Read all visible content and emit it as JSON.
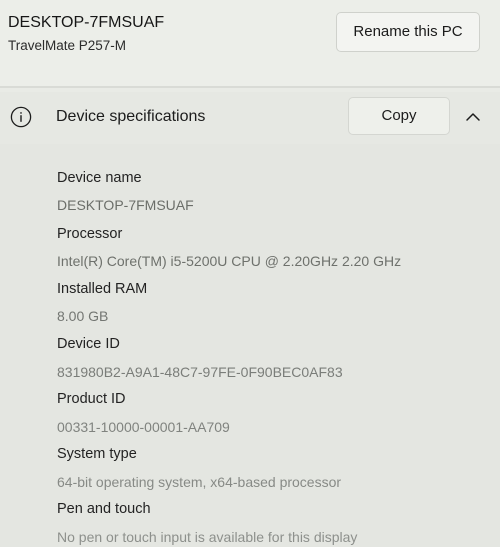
{
  "device": {
    "name": "DESKTOP-7FMSUAF",
    "model": "TravelMate P257-M",
    "rename_label": "Rename this PC"
  },
  "specifications": {
    "title": "Device specifications",
    "copy_label": "Copy",
    "items": [
      {
        "label": "Device name",
        "value": "DESKTOP-7FMSUAF"
      },
      {
        "label": "Processor",
        "value": "Intel(R) Core(TM) i5-5200U CPU @ 2.20GHz   2.20 GHz"
      },
      {
        "label": "Installed RAM",
        "value": "8.00 GB"
      },
      {
        "label": "Device ID",
        "value": "831980B2-A9A1-48C7-97FE-0F90BEC0AF83"
      },
      {
        "label": "Product ID",
        "value": "00331-10000-00001-AA709"
      },
      {
        "label": "System type",
        "value": "64-bit operating system, x64-based processor"
      },
      {
        "label": "Pen and touch",
        "value": "No pen or touch input is available for this display"
      }
    ]
  },
  "icons": {
    "info": "info-icon",
    "collapse": "chevron-up-icon"
  },
  "colors": {
    "background": "#e9ebe6",
    "text": "#1b1b1b",
    "value_text": "#6b6e6a"
  }
}
